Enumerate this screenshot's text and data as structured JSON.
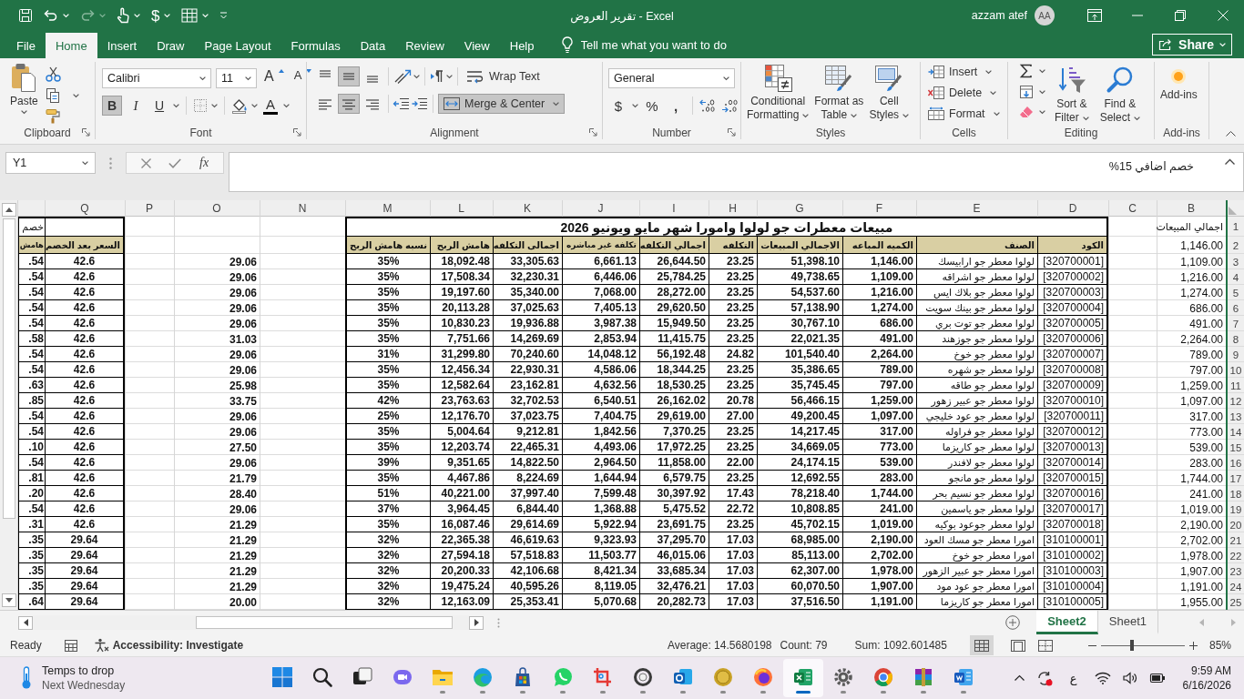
{
  "title_bar": {
    "title": "تقرير العروض  -  Excel",
    "user_name": "azzam atef",
    "user_initials": "AA",
    "currency_button": "$",
    "redo_disabled": true
  },
  "ribbon_tabs": [
    {
      "label": "File",
      "selected": false
    },
    {
      "label": "Home",
      "selected": true
    },
    {
      "label": "Insert",
      "selected": false
    },
    {
      "label": "Draw",
      "selected": false
    },
    {
      "label": "Page Layout",
      "selected": false
    },
    {
      "label": "Formulas",
      "selected": false
    },
    {
      "label": "Data",
      "selected": false
    },
    {
      "label": "Review",
      "selected": false
    },
    {
      "label": "View",
      "selected": false
    },
    {
      "label": "Help",
      "selected": false
    }
  ],
  "tell_me": {
    "placeholder": "Tell me what you want to do"
  },
  "share_button": "Share",
  "ribbon": {
    "clipboard": {
      "group_label": "Clipboard",
      "paste": "Paste"
    },
    "font": {
      "group_label": "Font",
      "font_name": "Calibri",
      "font_size": "11",
      "grow_font": "A",
      "shrink_font": "A",
      "bold": {
        "glyph": "B",
        "on": true
      },
      "italic": {
        "glyph": "I",
        "on": false
      },
      "underline": {
        "glyph": "U",
        "on": false
      },
      "font_color": "A"
    },
    "alignment": {
      "group_label": "Alignment",
      "vertical": [
        {
          "on": false
        },
        {
          "on": true
        },
        {
          "on": false
        }
      ],
      "horizontal": [
        {
          "on": false
        },
        {
          "on": true
        },
        {
          "on": false
        }
      ],
      "wrap_text": {
        "label": "Wrap Text",
        "on": false
      },
      "merge_center": {
        "label": "Merge & Center",
        "on": true
      }
    },
    "number": {
      "group_label": "Number",
      "format": "General",
      "currency": "$",
      "percent": "%",
      "comma": ","
    },
    "styles": {
      "group_label": "Styles",
      "buttons": [
        "Conditional\nFormatting",
        "Format as\nTable",
        "Cell\nStyles"
      ]
    },
    "cells": {
      "group_label": "Cells",
      "buttons": [
        "Insert",
        "Delete",
        "Format"
      ]
    },
    "editing": {
      "group_label": "Editing",
      "buttons": [
        "Sort &\nFilter",
        "Find &\nSelect"
      ]
    },
    "add_ins": {
      "group_label": "Add-ins",
      "button": "Add-ins"
    }
  },
  "formula_bar": {
    "name_box": "Y1",
    "function_symbol": "fx",
    "formula": "خصم اضافي 15%"
  },
  "sheet": {
    "columns": [
      "Q",
      "P",
      "O",
      "N",
      "M",
      "L",
      "K",
      "J",
      "I",
      "H",
      "G",
      "F",
      "E",
      "D",
      "C",
      "B"
    ],
    "rows": [
      {
        "number": "1",
        "cells": {
          "B": "اجمالي المبيعات",
          "D": "مبيعات معطرات جو لولوا وامورا شهر مايو ويونيو 2026",
          "partial": "خصم"
        }
      },
      {
        "number": "2",
        "cells": {
          "B": "1,146.00",
          "D": "الكود",
          "E": "الصنف",
          "F": "الكميه المباعه",
          "G": "الاجمالي المبيعات",
          "H": "التكلفه",
          "I": "اجمالي التكلفه",
          "J": "تكلفه غير مباشره",
          "K": "اجمالى التكلفه",
          "L": "هامش الربح",
          "M": "نسبه هامش الربح",
          "Q": "السعر بعد الخصم",
          "partial": "هامش"
        }
      },
      {
        "number": "3",
        "cells": {
          "B": "1,109.00",
          "D": "[320700001]",
          "E": "لولوا معطر جو ارابيسك",
          "F": "1,146.00",
          "G": "51,398.10",
          "H": "23.25",
          "I": "26,644.50",
          "J": "6,661.13",
          "K": "33,305.63",
          "L": "18,092.48",
          "M": "35%",
          "O": "29.06",
          "Q": "42.6",
          "partial": ".54"
        }
      },
      {
        "number": "4",
        "cells": {
          "B": "1,216.00",
          "D": "[320700002]",
          "E": "لولوا معطر جو اشراقه",
          "F": "1,109.00",
          "G": "49,738.65",
          "H": "23.25",
          "I": "25,784.25",
          "J": "6,446.06",
          "K": "32,230.31",
          "L": "17,508.34",
          "M": "35%",
          "O": "29.06",
          "Q": "42.6",
          "partial": ".54"
        }
      },
      {
        "number": "5",
        "cells": {
          "B": "1,274.00",
          "D": "[320700003]",
          "E": "لولوا معطر جو بلاك ايس",
          "F": "1,216.00",
          "G": "54,537.60",
          "H": "23.25",
          "I": "28,272.00",
          "J": "7,068.00",
          "K": "35,340.00",
          "L": "19,197.60",
          "M": "35%",
          "O": "29.06",
          "Q": "42.6",
          "partial": ".54"
        }
      },
      {
        "number": "6",
        "cells": {
          "B": "686.00",
          "D": "[320700004]",
          "E": "لولوا معطر جو بينك سويت",
          "F": "1,274.00",
          "G": "57,138.90",
          "H": "23.25",
          "I": "29,620.50",
          "J": "7,405.13",
          "K": "37,025.63",
          "L": "20,113.28",
          "M": "35%",
          "O": "29.06",
          "Q": "42.6",
          "partial": ".54"
        }
      },
      {
        "number": "7",
        "cells": {
          "B": "491.00",
          "D": "[320700005]",
          "E": "لولوا معطر جو توت بري",
          "F": "686.00",
          "G": "30,767.10",
          "H": "23.25",
          "I": "15,949.50",
          "J": "3,987.38",
          "K": "19,936.88",
          "L": "10,830.23",
          "M": "35%",
          "O": "29.06",
          "Q": "42.6",
          "partial": ".54"
        }
      },
      {
        "number": "8",
        "cells": {
          "B": "2,264.00",
          "D": "[320700006]",
          "E": "لولوا معطر جو جوزهند",
          "F": "491.00",
          "G": "22,021.35",
          "H": "23.25",
          "I": "11,415.75",
          "J": "2,853.94",
          "K": "14,269.69",
          "L": "7,751.66",
          "M": "35%",
          "O": "31.03",
          "Q": "42.6",
          "partial": ".58"
        }
      },
      {
        "number": "9",
        "cells": {
          "B": "789.00",
          "D": "[320700007]",
          "E": "لولوا معطر جو خوخ",
          "F": "2,264.00",
          "G": "101,540.40",
          "H": "24.82",
          "I": "56,192.48",
          "J": "14,048.12",
          "K": "70,240.60",
          "L": "31,299.80",
          "M": "31%",
          "O": "29.06",
          "Q": "42.6",
          "partial": ".54"
        }
      },
      {
        "number": "10",
        "cells": {
          "B": "797.00",
          "D": "[320700008]",
          "E": "لولوا معطر جو شهره",
          "F": "789.00",
          "G": "35,386.65",
          "H": "23.25",
          "I": "18,344.25",
          "J": "4,586.06",
          "K": "22,930.31",
          "L": "12,456.34",
          "M": "35%",
          "O": "29.06",
          "Q": "42.6",
          "partial": ".54"
        }
      },
      {
        "number": "11",
        "cells": {
          "B": "1,259.00",
          "D": "[320700009]",
          "E": "لولوا معطر جو طاقه",
          "F": "797.00",
          "G": "35,745.45",
          "H": "23.25",
          "I": "18,530.25",
          "J": "4,632.56",
          "K": "23,162.81",
          "L": "12,582.64",
          "M": "35%",
          "O": "25.98",
          "Q": "42.6",
          "partial": ".63"
        }
      },
      {
        "number": "12",
        "cells": {
          "B": "1,097.00",
          "D": "[320700010]",
          "E": "لولوا معطر جو عبير زهور",
          "F": "1,259.00",
          "G": "56,466.15",
          "H": "20.78",
          "I": "26,162.02",
          "J": "6,540.51",
          "K": "32,702.53",
          "L": "23,763.63",
          "M": "42%",
          "O": "33.75",
          "Q": "42.6",
          "partial": ".85"
        }
      },
      {
        "number": "13",
        "cells": {
          "B": "317.00",
          "D": "[320700011]",
          "E": "لولوا معطر جو عود خليجي",
          "F": "1,097.00",
          "G": "49,200.45",
          "H": "27.00",
          "I": "29,619.00",
          "J": "7,404.75",
          "K": "37,023.75",
          "L": "12,176.70",
          "M": "25%",
          "O": "29.06",
          "Q": "42.6",
          "partial": ".54"
        }
      },
      {
        "number": "14",
        "cells": {
          "B": "773.00",
          "D": "[320700012]",
          "E": "لولوا معطر جو فراوله",
          "F": "317.00",
          "G": "14,217.45",
          "H": "23.25",
          "I": "7,370.25",
          "J": "1,842.56",
          "K": "9,212.81",
          "L": "5,004.64",
          "M": "35%",
          "O": "29.06",
          "Q": "42.6",
          "partial": ".54"
        }
      },
      {
        "number": "15",
        "cells": {
          "B": "539.00",
          "D": "[320700013]",
          "E": "لولوا معطر جو كاريزما",
          "F": "773.00",
          "G": "34,669.05",
          "H": "23.25",
          "I": "17,972.25",
          "J": "4,493.06",
          "K": "22,465.31",
          "L": "12,203.74",
          "M": "35%",
          "O": "27.50",
          "Q": "42.6",
          "partial": ".10"
        }
      },
      {
        "number": "16",
        "cells": {
          "B": "283.00",
          "D": "[320700014]",
          "E": "لولوا معطر جو لافندر",
          "F": "539.00",
          "G": "24,174.15",
          "H": "22.00",
          "I": "11,858.00",
          "J": "2,964.50",
          "K": "14,822.50",
          "L": "9,351.65",
          "M": "39%",
          "O": "29.06",
          "Q": "42.6",
          "partial": ".54"
        }
      },
      {
        "number": "17",
        "cells": {
          "B": "1,744.00",
          "D": "[320700015]",
          "E": "لولوا معطر جو مانجو",
          "F": "283.00",
          "G": "12,692.55",
          "H": "23.25",
          "I": "6,579.75",
          "J": "1,644.94",
          "K": "8,224.69",
          "L": "4,467.86",
          "M": "35%",
          "O": "21.79",
          "Q": "42.6",
          "partial": ".81"
        }
      },
      {
        "number": "18",
        "cells": {
          "B": "241.00",
          "D": "[320700016]",
          "E": "لولوا معطر جو نسيم بحر",
          "F": "1,744.00",
          "G": "78,218.40",
          "H": "17.43",
          "I": "30,397.92",
          "J": "7,599.48",
          "K": "37,997.40",
          "L": "40,221.00",
          "M": "51%",
          "O": "28.40",
          "Q": "42.6",
          "partial": ".20"
        }
      },
      {
        "number": "19",
        "cells": {
          "B": "1,019.00",
          "D": "[320700017]",
          "E": "لولوا معطر جو ياسمين",
          "F": "241.00",
          "G": "10,808.85",
          "H": "22.72",
          "I": "5,475.52",
          "J": "1,368.88",
          "K": "6,844.40",
          "L": "3,964.45",
          "M": "37%",
          "O": "29.06",
          "Q": "42.6",
          "partial": ".54"
        }
      },
      {
        "number": "20",
        "cells": {
          "B": "2,190.00",
          "D": "[320700018]",
          "E": "لولوا معطر جوعود بوكيه",
          "F": "1,019.00",
          "G": "45,702.15",
          "H": "23.25",
          "I": "23,691.75",
          "J": "5,922.94",
          "K": "29,614.69",
          "L": "16,087.46",
          "M": "35%",
          "O": "21.29",
          "Q": "42.6",
          "partial": ".31"
        }
      },
      {
        "number": "21",
        "cells": {
          "B": "2,702.00",
          "D": "[310100001]",
          "E": "امورا معطر جو مسك العود",
          "F": "2,190.00",
          "G": "68,985.00",
          "H": "17.03",
          "I": "37,295.70",
          "J": "9,323.93",
          "K": "46,619.63",
          "L": "22,365.38",
          "M": "32%",
          "O": "21.29",
          "Q": "29.64",
          "partial": ".35"
        }
      },
      {
        "number": "22",
        "cells": {
          "B": "1,978.00",
          "D": "[310100002]",
          "E": "امورا معطر جو خوخ",
          "F": "2,702.00",
          "G": "85,113.00",
          "H": "17.03",
          "I": "46,015.06",
          "J": "11,503.77",
          "K": "57,518.83",
          "L": "27,594.18",
          "M": "32%",
          "O": "21.29",
          "Q": "29.64",
          "partial": ".35"
        }
      },
      {
        "number": "23",
        "cells": {
          "B": "1,907.00",
          "D": "[310100003]",
          "E": "امورا معطر جو عبير الزهور",
          "F": "1,978.00",
          "G": "62,307.00",
          "H": "17.03",
          "I": "33,685.34",
          "J": "8,421.34",
          "K": "42,106.68",
          "L": "20,200.33",
          "M": "32%",
          "O": "21.29",
          "Q": "29.64",
          "partial": ".35"
        }
      },
      {
        "number": "24",
        "cells": {
          "B": "1,191.00",
          "D": "[310100004]",
          "E": "امورا معطر جو عود مود",
          "F": "1,907.00",
          "G": "60,070.50",
          "H": "17.03",
          "I": "32,476.21",
          "J": "8,119.05",
          "K": "40,595.26",
          "L": "19,475.24",
          "M": "32%",
          "O": "21.29",
          "Q": "29.64",
          "partial": ".35"
        }
      },
      {
        "number": "25",
        "cells": {
          "B": "1,955.00",
          "D": "[310100005]",
          "E": "امورا معطر جو كاريزما",
          "F": "1,191.00",
          "G": "37,516.50",
          "H": "17.03",
          "I": "20,282.73",
          "J": "5,070.68",
          "K": "25,353.41",
          "L": "12,163.09",
          "M": "32%",
          "O": "20.00",
          "Q": "29.64",
          "partial": ".64"
        }
      }
    ]
  },
  "sheet_tabs": [
    {
      "label": "Sheet2",
      "selected": true
    },
    {
      "label": "Sheet1",
      "selected": false
    }
  ],
  "status_bar": {
    "mode": "Ready",
    "accessibility": "Accessibility: Investigate",
    "average": "Average: 14.5680198",
    "count": "Count: 79",
    "sum": "Sum: 1092.601485",
    "views": [
      {
        "selected": true
      },
      {
        "selected": false
      },
      {
        "selected": false
      }
    ],
    "zoom": {
      "level": 0.37,
      "reading": "85%"
    }
  },
  "taskbar": {
    "weather": {
      "headline": "Temps to drop",
      "detail": "Next Wednesday"
    },
    "apps": [
      {
        "running": false,
        "active": false
      },
      {
        "running": false,
        "active": false
      },
      {
        "running": false,
        "active": false
      },
      {
        "running": false,
        "active": false
      },
      {
        "running": true,
        "active": false
      },
      {
        "running": true,
        "active": false
      },
      {
        "running": true,
        "active": false
      },
      {
        "running": true,
        "active": false
      },
      {
        "running": true,
        "active": false
      },
      {
        "running": true,
        "active": false
      },
      {
        "running": true,
        "active": false
      },
      {
        "running": true,
        "active": false
      },
      {
        "running": true,
        "active": false
      },
      {
        "running": true,
        "active": true
      },
      {
        "running": true,
        "active": false
      },
      {
        "running": true,
        "active": false
      },
      {
        "running": true,
        "active": false
      },
      {
        "running": true,
        "active": false
      }
    ],
    "language": "ع",
    "time": "9:59 AM",
    "date": "6/16/2026"
  }
}
